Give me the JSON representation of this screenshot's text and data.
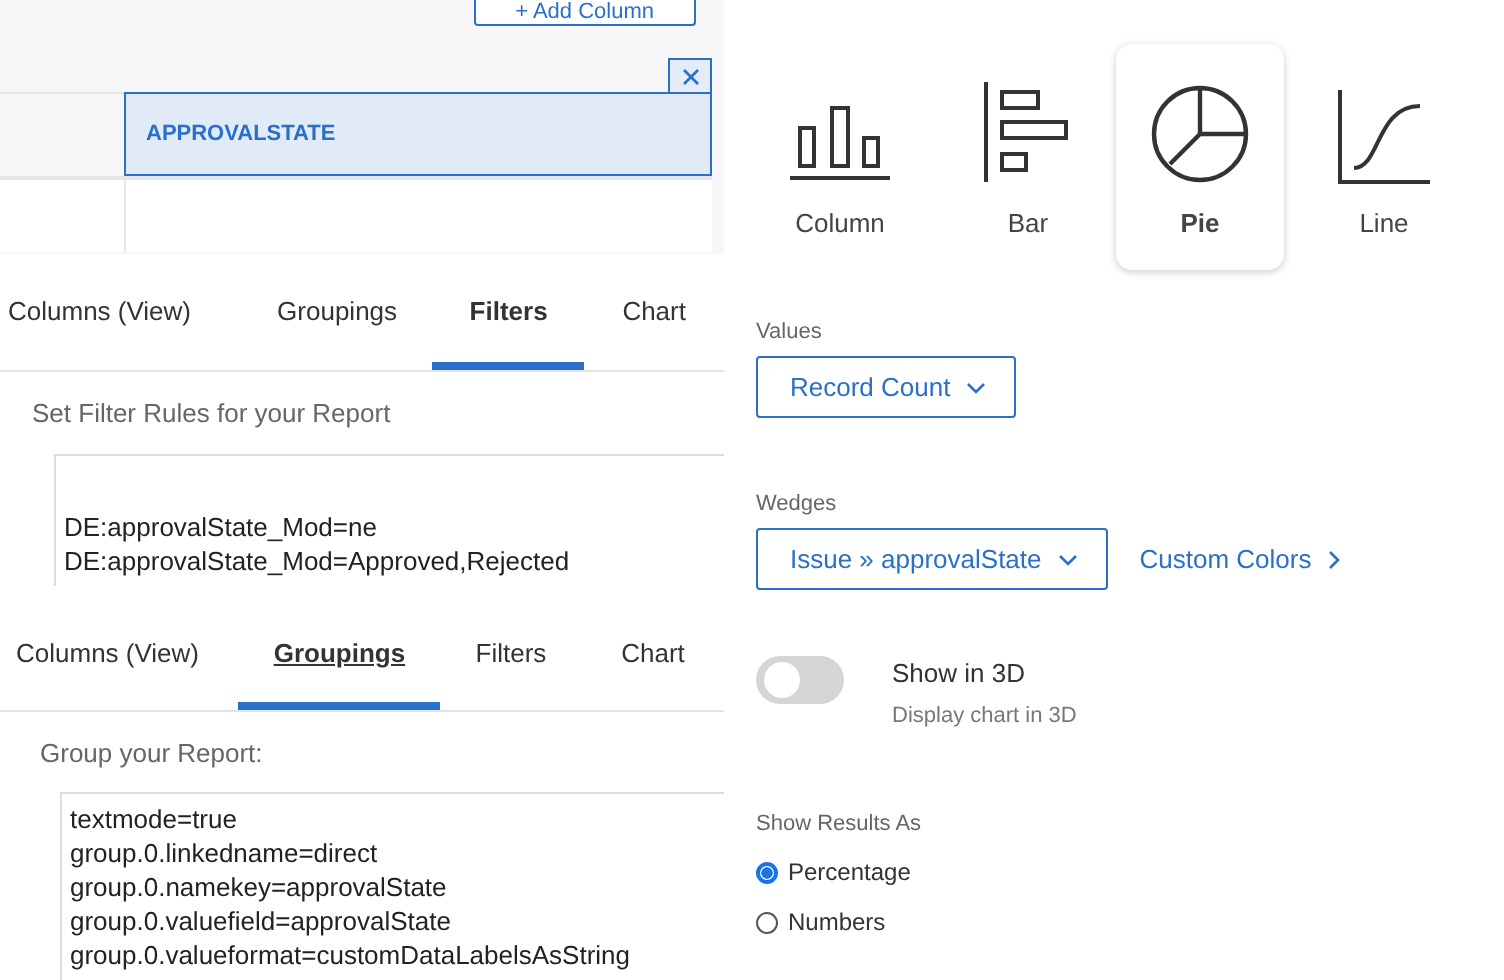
{
  "toolbar": {
    "add_column_button": "+ Add Column"
  },
  "column_table": {
    "header": "APPROVALSTATE",
    "selected": true
  },
  "filters_panel": {
    "tabs": [
      {
        "label": "Columns (View)",
        "selected": false
      },
      {
        "label": "Groupings",
        "selected": false
      },
      {
        "label": "Filters",
        "selected": true
      },
      {
        "label": "Chart",
        "selected": false
      }
    ],
    "heading": "Set Filter Rules for your Report",
    "rules": [
      "DE:approvalState_Mod=ne",
      "DE:approvalState_Mod=Approved,Rejected"
    ]
  },
  "groupings_panel": {
    "tabs": [
      {
        "label": "Columns (View)",
        "selected": false
      },
      {
        "label": "Groupings",
        "selected": true
      },
      {
        "label": "Filters",
        "selected": false
      },
      {
        "label": "Chart",
        "selected": false
      }
    ],
    "heading": "Group your Report:",
    "rules": [
      "textmode=true",
      "group.0.linkedname=direct",
      "group.0.namekey=approvalState",
      "group.0.valuefield=approvalState",
      "group.0.valueformat=customDataLabelsAsString"
    ]
  },
  "chart_settings": {
    "chart_types": [
      {
        "label": "Column",
        "kind": "column",
        "selected": false
      },
      {
        "label": "Bar",
        "kind": "bar",
        "selected": false
      },
      {
        "label": "Pie",
        "kind": "pie",
        "selected": true
      },
      {
        "label": "Line",
        "kind": "line",
        "selected": false
      }
    ],
    "values_label": "Values",
    "values_dropdown": "Record Count",
    "wedges_label": "Wedges",
    "wedges_dropdown": "Issue » approvalState",
    "custom_colors_link": "Custom Colors",
    "show_3d": {
      "on": false,
      "label": "Show in 3D",
      "description": "Display chart in 3D"
    },
    "results": {
      "label": "Show Results As",
      "options": [
        {
          "label": "Percentage",
          "selected": true
        },
        {
          "label": "Numbers",
          "selected": false
        }
      ]
    }
  }
}
